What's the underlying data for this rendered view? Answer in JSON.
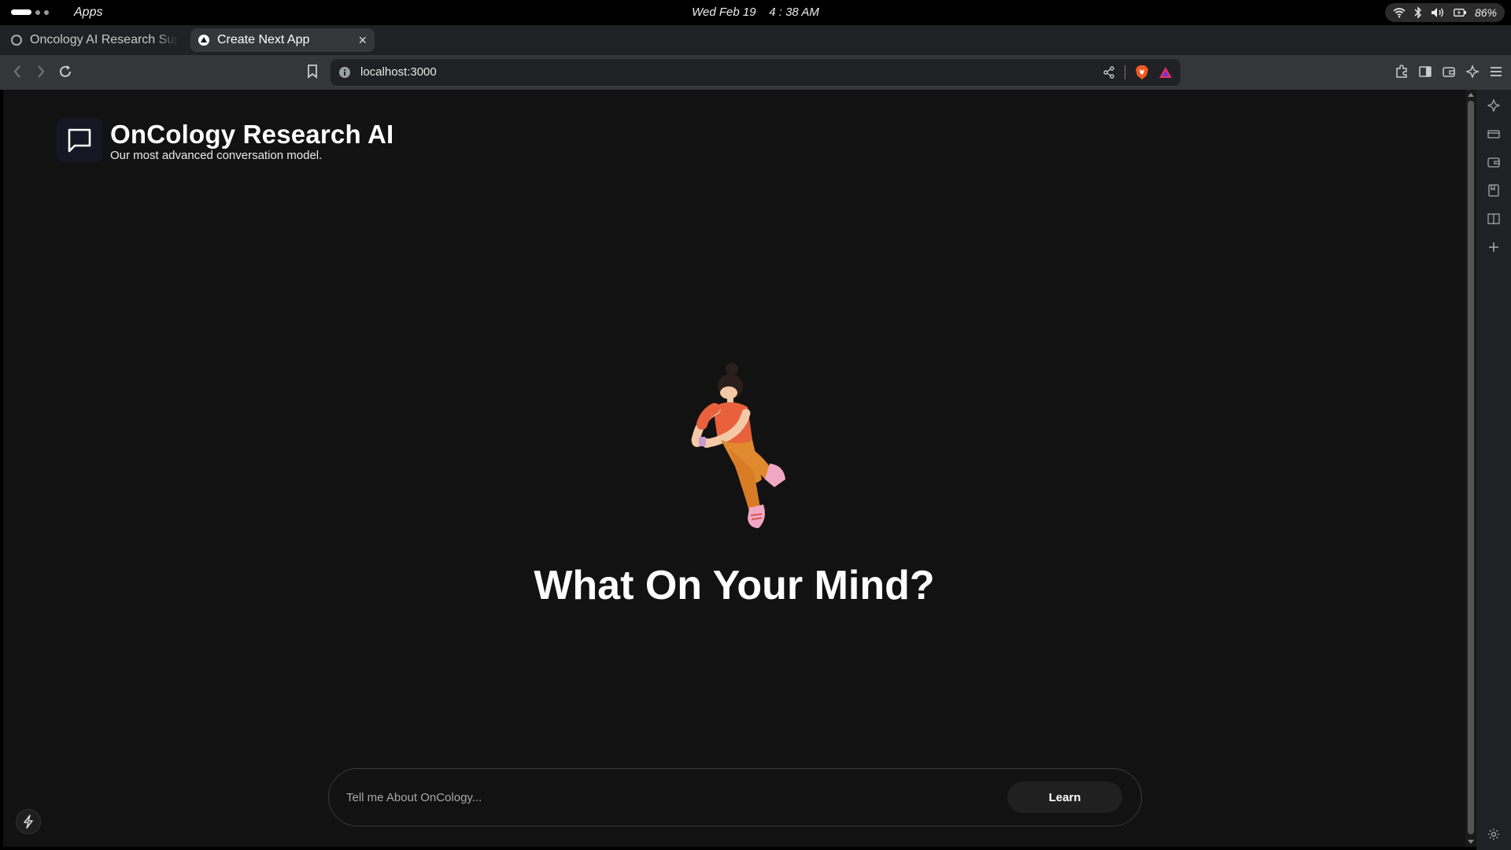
{
  "system_bar": {
    "apps_label": "Apps",
    "datetime": "Wed Feb 19    4 : 38 AM",
    "battery": "86%",
    "icons": [
      "wifi-icon",
      "bluetooth-icon",
      "volume-icon",
      "battery-icon"
    ]
  },
  "browser": {
    "tabs": [
      {
        "title": "Oncology AI Research Supp",
        "active": false
      },
      {
        "title": "Create Next App",
        "active": true
      }
    ],
    "url": "localhost:3000"
  },
  "app": {
    "title": "OnCology Research AI",
    "subtitle": "Our most advanced conversation model.",
    "heading": "What On Your Mind?",
    "input_placeholder": "Tell me About OnCology...",
    "submit_label": "Learn"
  },
  "colors": {
    "page_background": "#121212",
    "brand_box": "#171723",
    "figure_shirt": "#e8603c",
    "figure_pants": "#e0892e",
    "figure_shoes": "#f0a8c4"
  }
}
